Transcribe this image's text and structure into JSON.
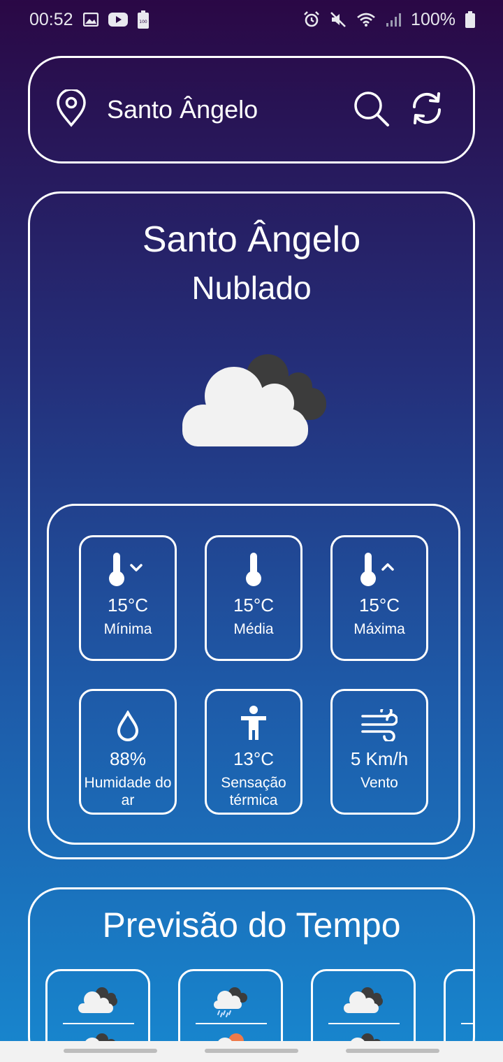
{
  "status_bar": {
    "time": "00:52",
    "battery": "100%",
    "left_icons": [
      "gallery-icon",
      "youtube-icon",
      "battery-saver-icon"
    ],
    "right_icons": [
      "alarm-icon",
      "mute-icon",
      "wifi-icon",
      "signal-icon",
      "battery-icon"
    ]
  },
  "search": {
    "location": "Santo Ângelo",
    "location_icon": "map-pin-icon",
    "search_icon": "search-icon",
    "refresh_icon": "refresh-icon"
  },
  "current": {
    "city": "Santo Ângelo",
    "condition": "Nublado",
    "icon": "cloudy-icon",
    "details": [
      {
        "icon": "thermometer-low-icon",
        "value": "15°C",
        "label": "Mínima"
      },
      {
        "icon": "thermometer-icon",
        "value": "15°C",
        "label": "Média"
      },
      {
        "icon": "thermometer-high-icon",
        "value": "15°C",
        "label": "Máxima"
      },
      {
        "icon": "droplet-icon",
        "value": "88%",
        "label": "Humidade do ar"
      },
      {
        "icon": "person-icon",
        "value": "13°C",
        "label": "Sensação térmica"
      },
      {
        "icon": "wind-icon",
        "value": "5 Km/h",
        "label": "Vento"
      }
    ]
  },
  "forecast": {
    "title": "Previsão do Tempo",
    "days": [
      {
        "icon": "cloudy-icon",
        "icon2": "cloudy-icon"
      },
      {
        "icon": "rain-icon",
        "icon2": "partly-cloudy-icon"
      },
      {
        "icon": "cloudy-icon",
        "icon2": "cloudy-icon"
      },
      {
        "icon": "cloudy-icon",
        "icon2": "cloudy-icon"
      }
    ]
  },
  "colors": {
    "top": "#2a0845",
    "middle": "#1e5aa8",
    "bottom": "#1787cf",
    "cloud_white": "#f2f2f2",
    "cloud_dark": "#3c3c3c"
  }
}
